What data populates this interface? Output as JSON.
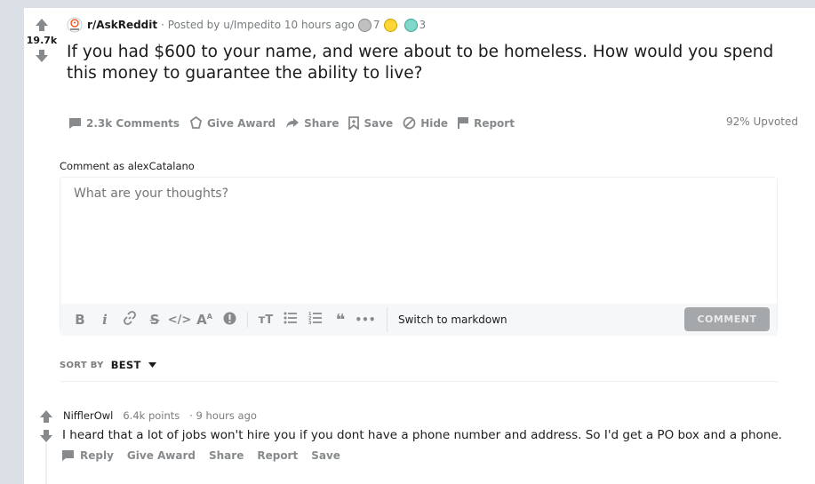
{
  "post": {
    "vote_count": "19.7k",
    "subreddit": "r/AskReddit",
    "posted_by": "· Posted by u/Impedito 10 hours ago",
    "award_count_silver": "7",
    "award_count_third": "3",
    "title": "If you had $600 to your name, and were about to be homeless. How would you spend this money to guarantee the ability to live?",
    "actions": {
      "comments": "2.3k Comments",
      "give_award": "Give Award",
      "share": "Share",
      "save": "Save",
      "hide": "Hide",
      "report": "Report"
    },
    "upvoted": "92% Upvoted"
  },
  "composer": {
    "comment_as": "Comment as alexCatalano",
    "placeholder": "What are your thoughts?",
    "switch_markdown": "Switch to markdown",
    "submit_label": "COMMENT"
  },
  "sort": {
    "label": "SORT BY",
    "value": "BEST"
  },
  "comment": {
    "author": "NifflerOwl",
    "points": "6.4k points",
    "time": "· 9 hours ago",
    "body": "I heard that a lot of jobs won't hire you if you dont have a phone number and address. So I'd get a PO box and a phone.",
    "actions": {
      "reply": "Reply",
      "give_award": "Give Award",
      "share": "Share",
      "report": "Report",
      "save": "Save"
    }
  },
  "colors": {
    "accent": "#0079d3",
    "muted": "#878a8c",
    "disabled_button": "#a4a8ab"
  }
}
